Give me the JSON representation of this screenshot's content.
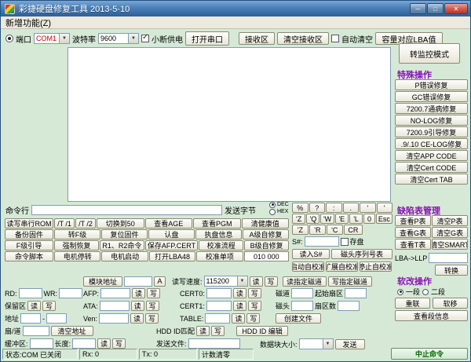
{
  "icons": {
    "chevron_down": "▼",
    "minimize": "─",
    "maximize": "□",
    "close": "✕"
  },
  "window": {
    "title": "彩捷硬盘修复工具 2013-5-10"
  },
  "menu": {
    "items": [
      "新增功能(Z)"
    ]
  },
  "toolbar": {
    "port_label": "端口",
    "port_value": "COM1",
    "baud_label": "波特率",
    "baud_value": "9600",
    "power_check_label": "小断供电",
    "open_serial": "打开串口",
    "receive_zone": "接收区",
    "clear_receive": "清空接收区",
    "auto_clear_label": "自动清空",
    "capacity_lba": "容量对应LBA值"
  },
  "special": {
    "monitor_button": "转监控模式",
    "label": "特殊操作",
    "buttons": [
      "P错误修复",
      "GC错误修复",
      "7200.7通病修复",
      "NO-LOG修复",
      "7200.9引导修复",
      ".9/.10 CE-LOG修复",
      "清空APP CODE",
      "清空Cert CODE",
      "清空Cert TAB"
    ]
  },
  "command": {
    "label": "命令行",
    "value": "",
    "send_bytes_label": "发送字节",
    "dec_label": "DEC",
    "hex_label": "HEX"
  },
  "keypad": {
    "row1": [
      "%",
      "?",
      ":",
      ".",
      "'",
      "'"
    ],
    "row2": [
      "'Z",
      "'Q",
      "'W",
      "'E",
      "'L",
      "0",
      "Esc"
    ],
    "row3": [
      "'Z",
      "'R",
      "'C",
      "CR"
    ]
  },
  "grid": {
    "rows": [
      [
        "读写串行ROM",
        "/T /1",
        "/T /2",
        "切换到50",
        "查看AGE",
        "查看PGM",
        "清健康值"
      ],
      [
        "备份固件",
        "转F级",
        "复位固件",
        "认盘",
        "执盘信息",
        "A级自修复"
      ],
      [
        "F级引导",
        "强制恢复",
        "R1、R2命令",
        "保存AFP.CERT",
        "校准流程",
        "B级自修复"
      ],
      [
        "命令脚本",
        "电机停转",
        "电机启动",
        "打开LBA48",
        "校准单项"
      ]
    ],
    "indicator": "010 000"
  },
  "sn": {
    "label": "S#:",
    "save_label": "存盘",
    "read_button": "读入S#",
    "head_table": "磁头序列号表"
  },
  "calibration": {
    "start": "启动自校准",
    "extend": "扩展自校准",
    "stop": "停止自校准"
  },
  "defect": {
    "label": "缺陷表管理",
    "pairs": [
      [
        "查看P表",
        "清空P表"
      ],
      [
        "查看G表",
        "清空G表"
      ],
      [
        "查看T表",
        "清空SMART"
      ]
    ],
    "lba_label": "LBA->LLP",
    "convert": "转换"
  },
  "softmod": {
    "label": "软改操作",
    "radio1": "一段",
    "radio2": "二段",
    "buttons": [
      "重联",
      "软移"
    ],
    "view_segment": "查看段信息"
  },
  "modules": {
    "module_addr_button": "模块地址",
    "module_a": "A",
    "speed_label": "读写速度:",
    "speed_value": "115200",
    "read": "读",
    "write": "写",
    "read_track": "读指定磁道",
    "write_track": "写指定磁道",
    "rd_label": "RD:",
    "wr_label": "WR:",
    "afp_label": "AFP:",
    "cert0_label": "CERT0:",
    "track_label": "磁道",
    "start_sector_label": "起始扇区",
    "reserved_label": "保留区",
    "ata_label": "ATA:",
    "cert1_label": "CERT1:",
    "head_label": "磁头",
    "sector_count_label": "扇区数",
    "addr_label": "地址",
    "addr_sep": "-",
    "ven_label": "Ven:",
    "table_label": "TABLE:",
    "create_file": "创建文件",
    "sector_track_label": "扇/道",
    "clear_addr": "清空地址",
    "hddid_match_label": "HDD ID匹配",
    "hddid_edit": "HDD ID 编辑",
    "buffer_label": "缓冲区:",
    "length_label": "长度:",
    "send_file_label": "发送文件:",
    "block_size_label": "数据块大小:",
    "send_button": "发送"
  },
  "status": {
    "state": "状态:COM 已关闭",
    "rx": "Rx: 0",
    "tx": "Tx: 0",
    "counter_reset": "计数清零",
    "abort": "中止命令"
  },
  "colors": {
    "background": "#d6e9d6",
    "titlebar": "#3b76b8",
    "accent_label": "#8a12b4",
    "com_port_text": "#cc0000",
    "abort_text": "#006600"
  }
}
